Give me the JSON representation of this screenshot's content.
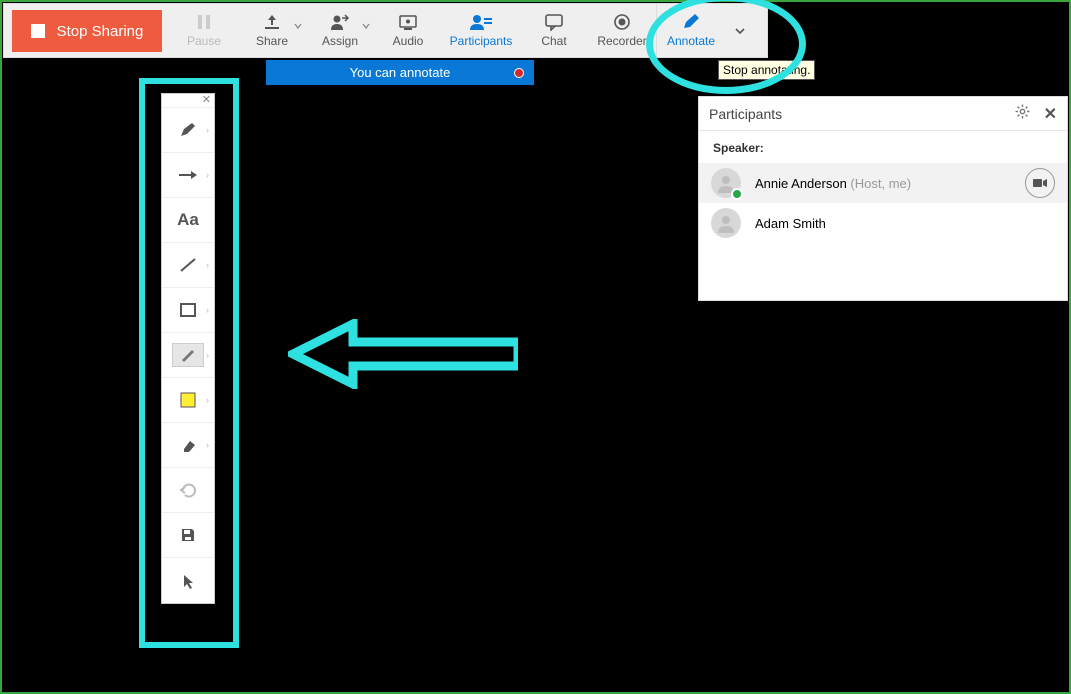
{
  "toolbar": {
    "stop_sharing": "Stop Sharing",
    "pause": "Pause",
    "share": "Share",
    "assign": "Assign",
    "audio": "Audio",
    "participants": "Participants",
    "chat": "Chat",
    "recorder": "Recorder",
    "annotate": "Annotate"
  },
  "tooltip": "Stop annotating.",
  "annotate_bar": "You can annotate",
  "tool_panel": {
    "items": [
      {
        "name": "pen-tool"
      },
      {
        "name": "arrow-tool"
      },
      {
        "name": "text-tool",
        "label": "Aa"
      },
      {
        "name": "line-tool"
      },
      {
        "name": "rectangle-tool"
      },
      {
        "name": "highlighter-tool"
      },
      {
        "name": "color-tool"
      },
      {
        "name": "eraser-tool"
      },
      {
        "name": "undo-tool"
      },
      {
        "name": "save-tool"
      },
      {
        "name": "cursor-tool"
      }
    ]
  },
  "participants": {
    "title": "Participants",
    "speaker_label": "Speaker:",
    "list": [
      {
        "name": "Annie Anderson",
        "role": "(Host, me)",
        "has_badge": true,
        "has_video": true
      },
      {
        "name": "Adam Smith",
        "role": "",
        "has_badge": false,
        "has_video": false
      }
    ]
  }
}
